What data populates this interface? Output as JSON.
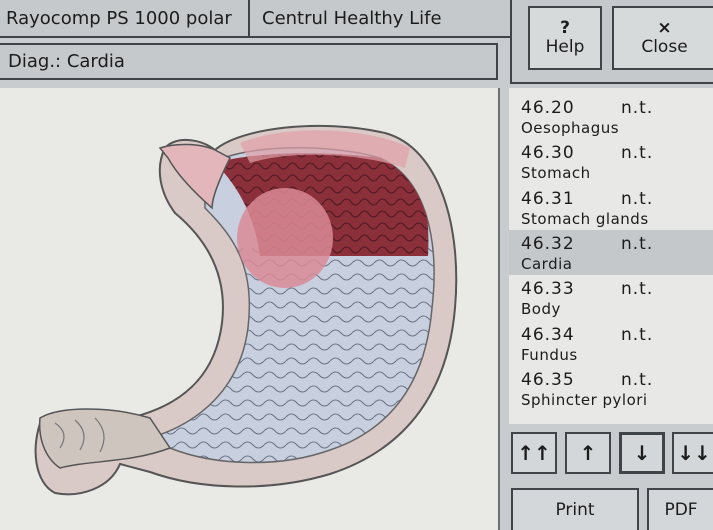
{
  "header": {
    "device_name": "Rayocomp PS 1000 polar",
    "client_name": "Centrul Healthy Life"
  },
  "diagnosis": {
    "label": "Diag.: Cardia"
  },
  "buttons": {
    "help": {
      "glyph": "?",
      "label": "Help"
    },
    "close": {
      "glyph": "×",
      "label": "Close"
    },
    "print": "Print",
    "pdf": "PDF"
  },
  "nav": {
    "top": "↑↑",
    "up": "↑",
    "down": "↓",
    "bottom": "↓↓"
  },
  "list": {
    "items": [
      {
        "code": "46.20",
        "status": "n.t.",
        "name": "Oesophagus",
        "selected": false
      },
      {
        "code": "46.30",
        "status": "n.t.",
        "name": "Stomach",
        "selected": false
      },
      {
        "code": "46.31",
        "status": "n.t.",
        "name": "Stomach glands",
        "selected": false
      },
      {
        "code": "46.32",
        "status": "n.t.",
        "name": "Cardia",
        "selected": true
      },
      {
        "code": "46.33",
        "status": "n.t.",
        "name": "Body",
        "selected": false
      },
      {
        "code": "46.34",
        "status": "n.t.",
        "name": "Fundus",
        "selected": false
      },
      {
        "code": "46.35",
        "status": "n.t.",
        "name": "Sphincter pylori",
        "selected": false
      }
    ]
  },
  "colors": {
    "highlight_red": "#8b2f3a",
    "highlight_pink": "#e0a0a8",
    "stomach_blue": "#c8d0e0",
    "selection": "#c4c8cb"
  },
  "image": {
    "subject": "stomach-anatomy-illustration"
  }
}
